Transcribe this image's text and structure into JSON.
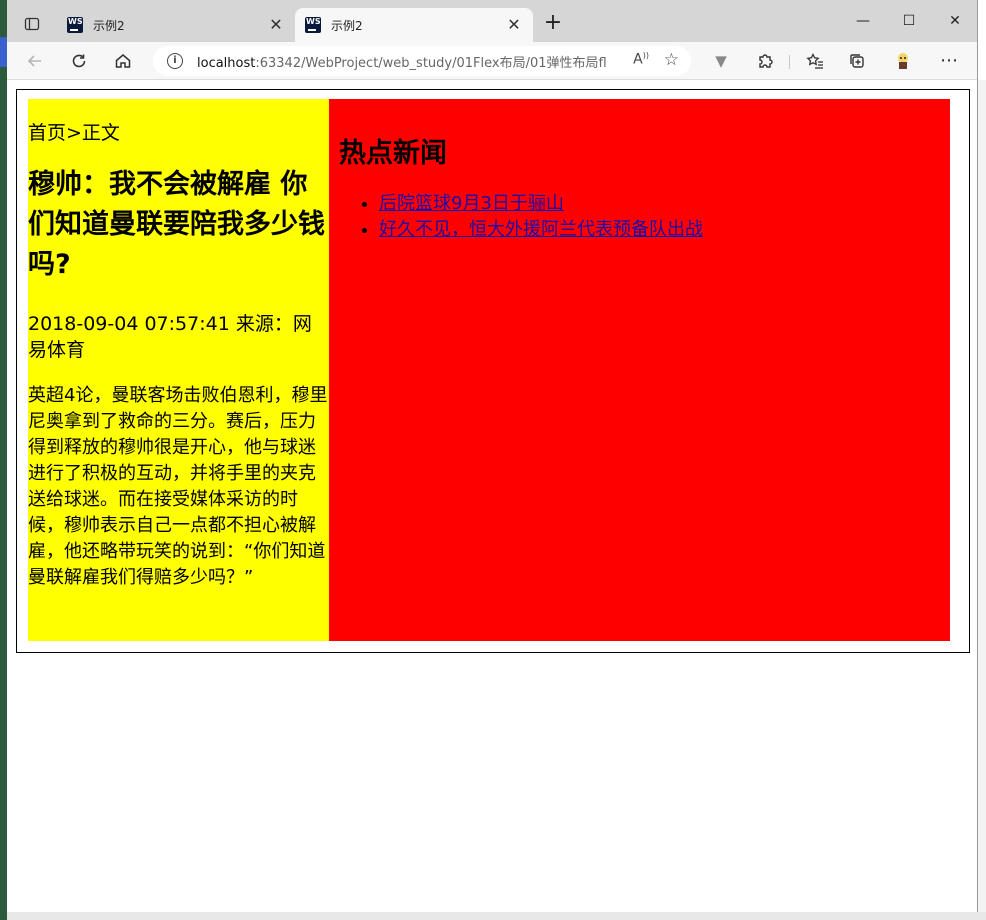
{
  "browser": {
    "tabs": [
      {
        "title": "示例2",
        "active": false
      },
      {
        "title": "示例2",
        "active": true
      }
    ],
    "window_controls": {
      "minimize": "—",
      "maximize": "☐",
      "close": "✕"
    },
    "address": {
      "host": "localhost",
      "path": ":63342/WebProject/web_study/01Flex布局/01弹性布局fl..."
    }
  },
  "page": {
    "breadcrumb": "首页>正文",
    "title": "穆帅：我不会被解雇 你们知道曼联要陪我多少钱吗?",
    "meta": "2018-09-04 07:57:41 来源：网易体育",
    "body": "英超4论，曼联客场击败伯恩利，穆里尼奥拿到了救命的三分。赛后，压力得到释放的穆帅很是开心，他与球迷进行了积极的互动，并将手里的夹克送给球迷。而在接受媒体采访的时候，穆帅表示自己一点都不担心被解雇，他还略带玩笑的说到：“你们知道曼联解雇我们得赔多少吗？”",
    "hot_news_title": "热点新闻",
    "hot_news": [
      "后院篮球9月3日于骊山",
      "好久不见，恒大外援阿兰代表预备队出战"
    ]
  },
  "colors": {
    "left_column": "#ffff00",
    "right_column": "#ff0000",
    "link": "#1a0dab"
  }
}
